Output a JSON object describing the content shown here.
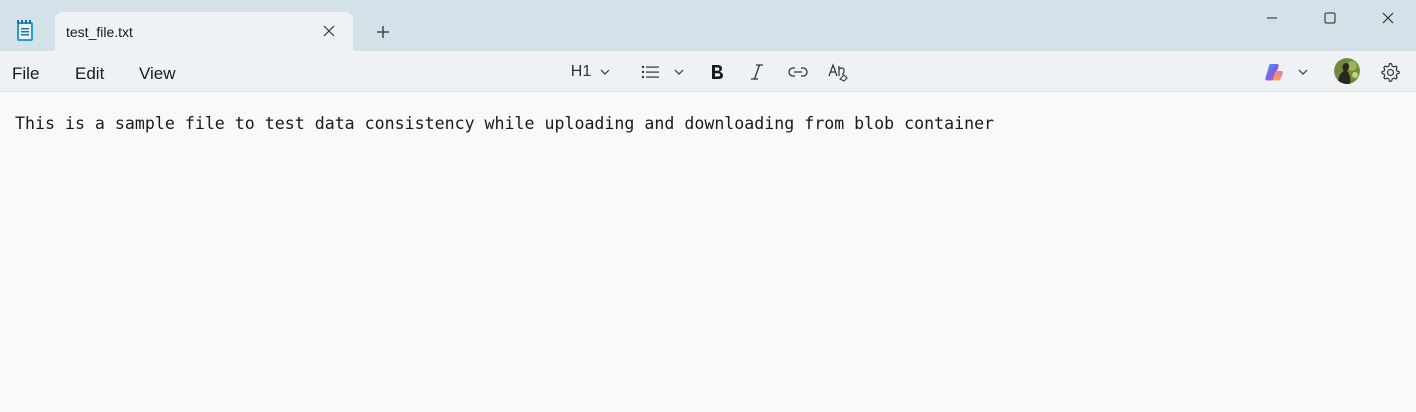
{
  "window": {
    "tab_title": "test_file.txt",
    "app_icon": "notepad-icon"
  },
  "window_controls": {
    "minimize": "minimize-icon",
    "maximize": "maximize-icon",
    "close": "close-icon"
  },
  "menu": {
    "file": "File",
    "edit": "Edit",
    "view": "View"
  },
  "toolbar": {
    "heading_label": "H1",
    "icons": [
      "list-icon",
      "bold-icon",
      "italic-icon",
      "link-icon",
      "clear-formatting-icon",
      "copilot-icon",
      "avatar",
      "gear-icon"
    ]
  },
  "editor": {
    "content": "This is a sample file to test data consistency while uploading and downloading from blob container"
  },
  "colors": {
    "titlebar": "#d3e1e9",
    "tab": "#eef2f5",
    "editor_bg": "#f9f9f9"
  }
}
